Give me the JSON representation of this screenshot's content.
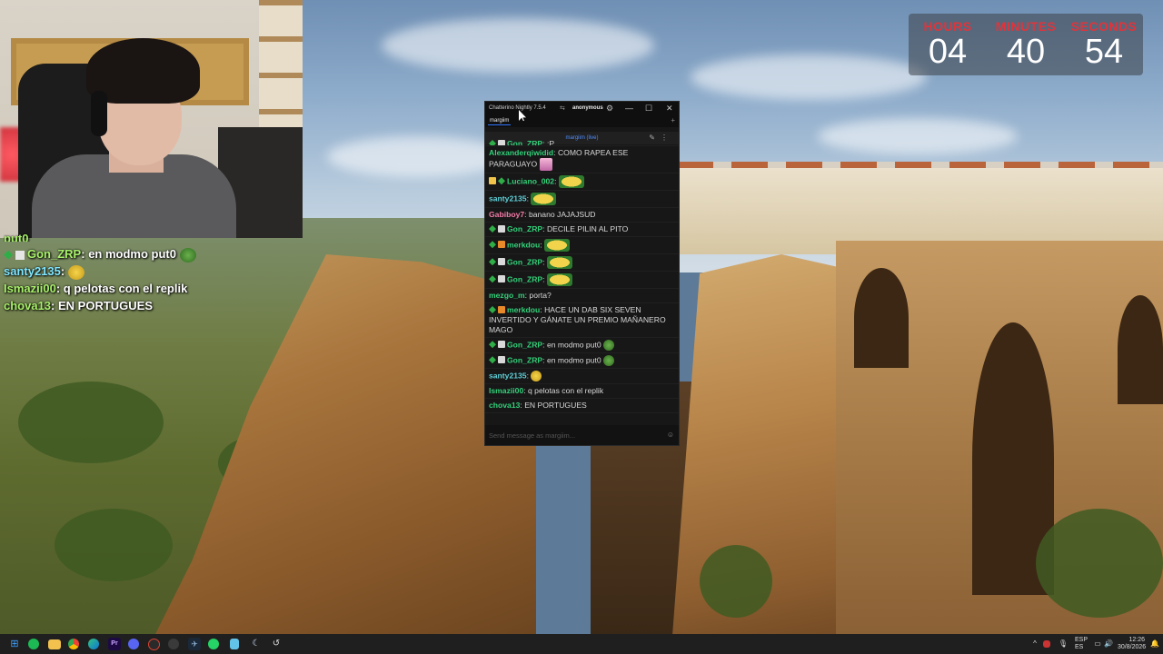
{
  "overlay_chat": [
    {
      "user": "Gon_ZRP",
      "text": "en modmo put0",
      "color": "green"
    },
    {
      "user": "santy2135",
      "text": "",
      "color": "cyan"
    },
    {
      "user": "Ismazii00",
      "text": "q pelotas con el replik",
      "color": "green"
    },
    {
      "user": "chova13",
      "text": "EN PORTUGUES",
      "color": "green"
    }
  ],
  "overlay_prefix": "put0",
  "timer": {
    "hours_label": "HOURS",
    "minutes_label": "MINUTES",
    "seconds_label": "SECONDS",
    "hours": "04",
    "minutes": "40",
    "seconds": "54",
    "label_color": "#e0343b"
  },
  "chatterino": {
    "title": "Chatterino Nightly 7.5.4",
    "account": "anonymous",
    "tab": "margiim",
    "channel": "margiim (live)",
    "input_placeholder": "Send message as margiim...",
    "messages": [
      {
        "user": "Gon_ZRP",
        "text": ":P"
      },
      {
        "user": "Alexanderqiwidid",
        "text": "COMO RAPEA ESE PARAGUAYO"
      },
      {
        "user": "Luciano_002",
        "text": ""
      },
      {
        "user": "santy2135",
        "text": ""
      },
      {
        "user": "Gabiboy7",
        "text": "banano JAJAJSUD"
      },
      {
        "user": "Gon_ZRP",
        "text": "DECILE PILIN AL PITO"
      },
      {
        "user": "merkdou",
        "text": ""
      },
      {
        "user": "Gon_ZRP",
        "text": ""
      },
      {
        "user": "Gon_ZRP",
        "text": ""
      },
      {
        "user": "mezgo_m",
        "text": "porta?"
      },
      {
        "user": "merkdou",
        "text": "HACE UN DAB SIX SEVEN INVERTIDO Y GÁNATE UN PREMIO MAÑANERO MAGO"
      },
      {
        "user": "Gon_ZRP",
        "text": "en modmo put0"
      },
      {
        "user": "Gon_ZRP",
        "text": "en modmo put0"
      },
      {
        "user": "santy2135",
        "text": ""
      },
      {
        "user": "Ismazii00",
        "text": "q pelotas con el replik"
      },
      {
        "user": "chova13",
        "text": "EN PORTUGUES"
      }
    ]
  },
  "taskbar": {
    "lang": "ESP",
    "lang2": "ES",
    "time": "12:26",
    "date": "30/8/2026"
  },
  "icons": [
    "windows-start-icon",
    "spotify-icon",
    "file-explorer-icon",
    "chrome-icon",
    "edge-icon",
    "premiere-icon",
    "discord-icon",
    "obs-icon",
    "chatterino-icon",
    "steam-icon",
    "whatsapp-icon",
    "notepad-icon",
    "chatterino-icon-2",
    "chatterino-icon-3"
  ]
}
